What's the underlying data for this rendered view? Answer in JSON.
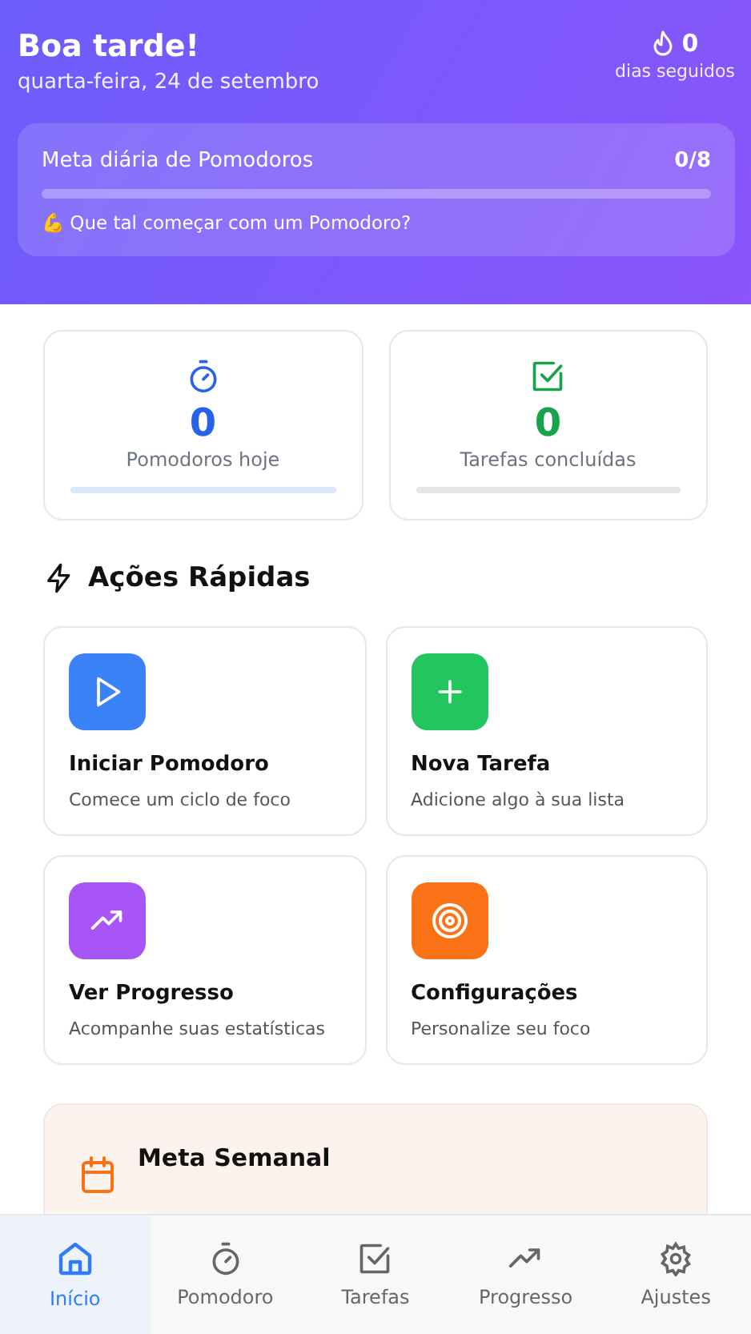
{
  "header": {
    "greeting": "Boa tarde!",
    "date": "quarta-feira, 24 de setembro",
    "streak": {
      "count": "0",
      "label": "dias seguidos"
    },
    "daily_goal": {
      "title": "Meta diária de Pomodoros",
      "count": "0/8",
      "level": 0,
      "message": "💪 Que tal começar com um Pomodoro?"
    }
  },
  "stats": [
    {
      "kind": "timer",
      "value": "0",
      "label": "Pomodoros hoje",
      "color": "#2563eb",
      "level": 0
    },
    {
      "kind": "check",
      "value": "0",
      "label": "Tarefas concluídas",
      "color": "#16a34a",
      "level": 0
    }
  ],
  "quick_actions": {
    "title": "Ações Rápidas",
    "items": [
      {
        "kind": "play",
        "title": "Iniciar Pomodoro",
        "subtitle": "Comece um ciclo de foco",
        "color": "#3b82f6"
      },
      {
        "kind": "plus",
        "title": "Nova Tarefa",
        "subtitle": "Adicione algo à sua lista",
        "color": "#22c55e"
      },
      {
        "kind": "trend",
        "title": "Ver Progresso",
        "subtitle": "Acompanhe suas estatísticas",
        "color": "#a855f7"
      },
      {
        "kind": "target",
        "title": "Configurações",
        "subtitle": "Personalize seu foco",
        "color": "#f97316"
      }
    ]
  },
  "weekly_goal": {
    "title": "Meta Semanal"
  },
  "nav": [
    {
      "kind": "home",
      "label": "Início",
      "selected": true
    },
    {
      "kind": "timer",
      "label": "Pomodoro",
      "selected": false
    },
    {
      "kind": "check",
      "label": "Tarefas",
      "selected": false
    },
    {
      "kind": "trend",
      "label": "Progresso",
      "selected": false
    },
    {
      "kind": "gear",
      "label": "Ajustes",
      "selected": false
    }
  ]
}
